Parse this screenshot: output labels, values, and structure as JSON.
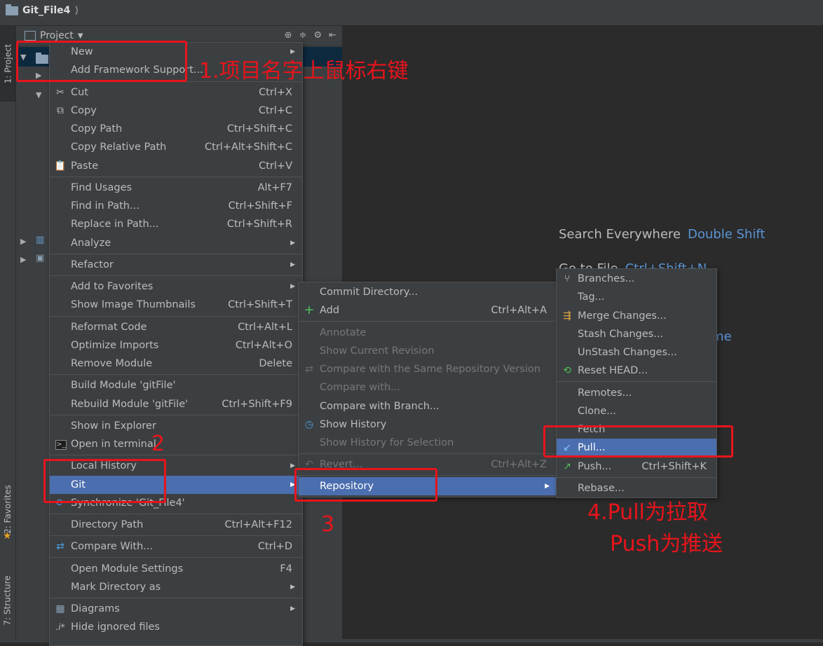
{
  "title_bar": {
    "project": "Git_File4"
  },
  "tool_windows": {
    "project": "1: Project",
    "favorites": "2: Favorites",
    "structure": "7: Structure"
  },
  "project_panel": {
    "title": "Project"
  },
  "welcome": {
    "search_everywhere": "Search Everywhere",
    "search_shortcut": "Double Shift",
    "goto_file": "Go to File",
    "goto_shortcut": "Ctrl+Shift+N",
    "partial_tail": "me"
  },
  "context_menu": {
    "items": [
      {
        "label": "New"
      },
      {
        "label": "Add Framework Support..."
      },
      {
        "label": "Cut",
        "shortcut": "Ctrl+X"
      },
      {
        "label": "Copy",
        "shortcut": "Ctrl+C"
      },
      {
        "label": "Copy Path",
        "shortcut": "Ctrl+Shift+C"
      },
      {
        "label": "Copy Relative Path",
        "shortcut": "Ctrl+Alt+Shift+C"
      },
      {
        "label": "Paste",
        "shortcut": "Ctrl+V"
      },
      {
        "label": "Find Usages",
        "shortcut": "Alt+F7"
      },
      {
        "label": "Find in Path...",
        "shortcut": "Ctrl+Shift+F"
      },
      {
        "label": "Replace in Path...",
        "shortcut": "Ctrl+Shift+R"
      },
      {
        "label": "Analyze"
      },
      {
        "label": "Refactor"
      },
      {
        "label": "Add to Favorites"
      },
      {
        "label": "Show Image Thumbnails",
        "shortcut": "Ctrl+Shift+T"
      },
      {
        "label": "Reformat Code",
        "shortcut": "Ctrl+Alt+L"
      },
      {
        "label": "Optimize Imports",
        "shortcut": "Ctrl+Alt+O"
      },
      {
        "label": "Remove Module",
        "shortcut": "Delete"
      },
      {
        "label": "Build Module 'gitFile'"
      },
      {
        "label": "Rebuild Module 'gitFile'",
        "shortcut": "Ctrl+Shift+F9"
      },
      {
        "label": "Show in Explorer"
      },
      {
        "label": "Open in terminal"
      },
      {
        "label": "Local History"
      },
      {
        "label": "Git"
      },
      {
        "label": "Synchronize 'Git_File4'"
      },
      {
        "label": "Directory Path",
        "shortcut": "Ctrl+Alt+F12"
      },
      {
        "label": "Compare With...",
        "shortcut": "Ctrl+D"
      },
      {
        "label": "Open Module Settings",
        "shortcut": "F4"
      },
      {
        "label": "Mark Directory as"
      },
      {
        "label": "Diagrams"
      },
      {
        "label": "Hide ignored files"
      }
    ]
  },
  "git_menu": {
    "items": [
      {
        "label": "Commit Directory..."
      },
      {
        "label": "Add",
        "shortcut": "Ctrl+Alt+A"
      },
      {
        "label": "Annotate"
      },
      {
        "label": "Show Current Revision"
      },
      {
        "label": "Compare with the Same Repository Version"
      },
      {
        "label": "Compare with..."
      },
      {
        "label": "Compare with Branch..."
      },
      {
        "label": "Show History"
      },
      {
        "label": "Show History for Selection"
      },
      {
        "label": "Revert...",
        "shortcut": "Ctrl+Alt+Z"
      },
      {
        "label": "Repository"
      }
    ]
  },
  "repo_menu": {
    "items": [
      {
        "label": "Branches..."
      },
      {
        "label": "Tag..."
      },
      {
        "label": "Merge Changes..."
      },
      {
        "label": "Stash Changes..."
      },
      {
        "label": "UnStash Changes..."
      },
      {
        "label": "Reset HEAD..."
      },
      {
        "label": "Remotes..."
      },
      {
        "label": "Clone..."
      },
      {
        "label": "Fetch"
      },
      {
        "label": "Pull..."
      },
      {
        "label": "Push...",
        "shortcut": "Ctrl+Shift+K"
      },
      {
        "label": "Rebase..."
      }
    ]
  },
  "annotations": {
    "step1": "1.项目名字上鼠标右键",
    "step2": "2",
    "step3": "3",
    "step4_line1": "4.Pull为拉取",
    "step4_line2": "Push为推送"
  },
  "colors": {
    "highlight": "#4b6eaf",
    "annotation": "#e8141c",
    "link": "#5a94d6"
  }
}
